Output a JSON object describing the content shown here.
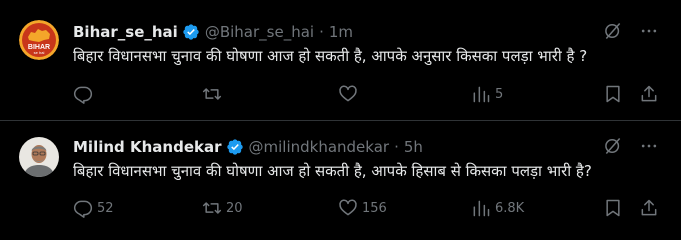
{
  "tweets": [
    {
      "display_name": "Bihar_se_hai",
      "handle": "@Bihar_se_hai",
      "separator": "·",
      "time": "1m",
      "avatar_text": "BIHAR",
      "avatar_subtext": "se hai",
      "text": "बिहार विधानसभा चुनाव की घोषणा आज हो सकती है, आपके  अनुसार किसका पलड़ा भारी है ?",
      "replies": "",
      "retweets": "",
      "likes": "",
      "views": "5"
    },
    {
      "display_name": "Milind Khandekar",
      "handle": "@milindkhandekar",
      "separator": "·",
      "time": "5h",
      "text": "बिहार विधानसभा चुनाव की घोषणा आज हो सकती है, आपके हिसाब से किसका पलड़ा भारी है?",
      "replies": "52",
      "retweets": "20",
      "likes": "156",
      "views": "6.8K"
    }
  ],
  "colors": {
    "background": "#000000",
    "text": "#e7e9ea",
    "muted": "#71767b",
    "verified": "#1d9bf0",
    "divider": "#2f3336"
  },
  "icons": [
    "verified-badge-icon",
    "grok-icon",
    "more-icon",
    "reply-icon",
    "retweet-icon",
    "like-icon",
    "views-icon",
    "bookmark-icon",
    "share-icon"
  ]
}
